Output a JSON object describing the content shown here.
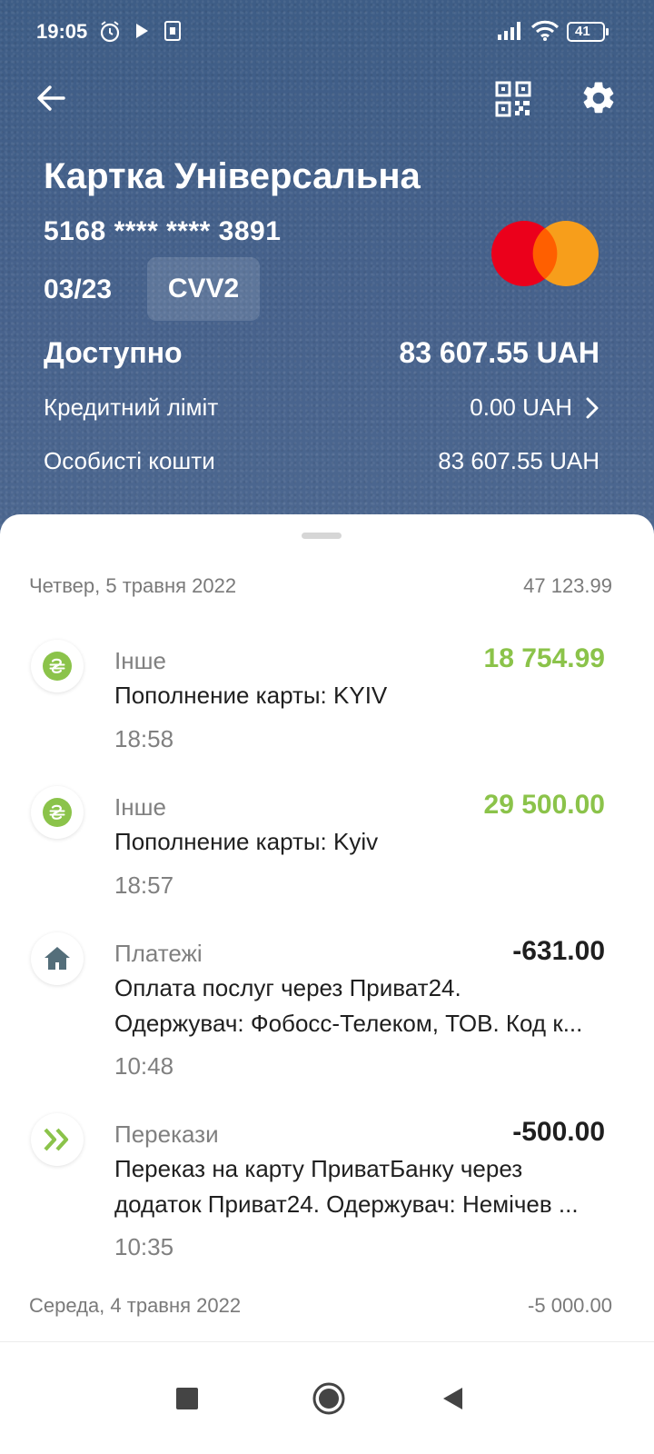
{
  "status_bar": {
    "time": "19:05",
    "battery": "41",
    "icons": [
      "alarm-icon",
      "play-icon",
      "sim-icon",
      "signal-icon",
      "wifi-icon",
      "battery-icon"
    ]
  },
  "toolbar": {
    "icons": [
      "back-arrow-icon",
      "qr-code-icon",
      "gear-icon"
    ]
  },
  "card": {
    "title": "Картка Універсальна",
    "number": "5168 **** **** 3891",
    "expiry": "03/23",
    "cvv_label": "CVV2",
    "brand": "mastercard",
    "available_label": "Доступно",
    "available_value": "83 607.55 UAH",
    "credit_limit_label": "Кредитний ліміт",
    "credit_limit_value": "0.00 UAH",
    "own_funds_label": "Особисті кошти",
    "own_funds_value": "83 607.55 UAH"
  },
  "colors": {
    "hero_bg": "#44618a",
    "positive": "#8bc34a",
    "negative": "#1f1f1f",
    "category_house": "#546e7a"
  },
  "days": [
    {
      "date": "Четвер, 5 травня 2022",
      "total": "47 123.99",
      "transactions": [
        {
          "icon": "hryvnia-icon",
          "category": "Інше",
          "amount": "18 754.99",
          "description_lines": [
            "Пополнение карты: KYIV"
          ],
          "time": "18:58"
        },
        {
          "icon": "hryvnia-icon",
          "category": "Інше",
          "amount": "29 500.00",
          "description_lines": [
            "Пополнение карты: Kyiv"
          ],
          "time": "18:57"
        },
        {
          "icon": "house-icon",
          "category": "Платежі",
          "amount": "-631.00",
          "description_lines": [
            "Оплата послуг через Приват24.",
            "Одержувач: Фобосс-Телеком, ТОВ. Код к..."
          ],
          "time": "10:48"
        },
        {
          "icon": "double-chevron-icon",
          "category": "Перекази",
          "amount": "-500.00",
          "description_lines": [
            "Переказ на карту ПриватБанку через",
            "додаток Приват24. Одержувач: Немічев ..."
          ],
          "time": "10:35"
        }
      ]
    },
    {
      "date": "Середа, 4 травня 2022",
      "total": "-5 000.00",
      "transactions": []
    }
  ]
}
